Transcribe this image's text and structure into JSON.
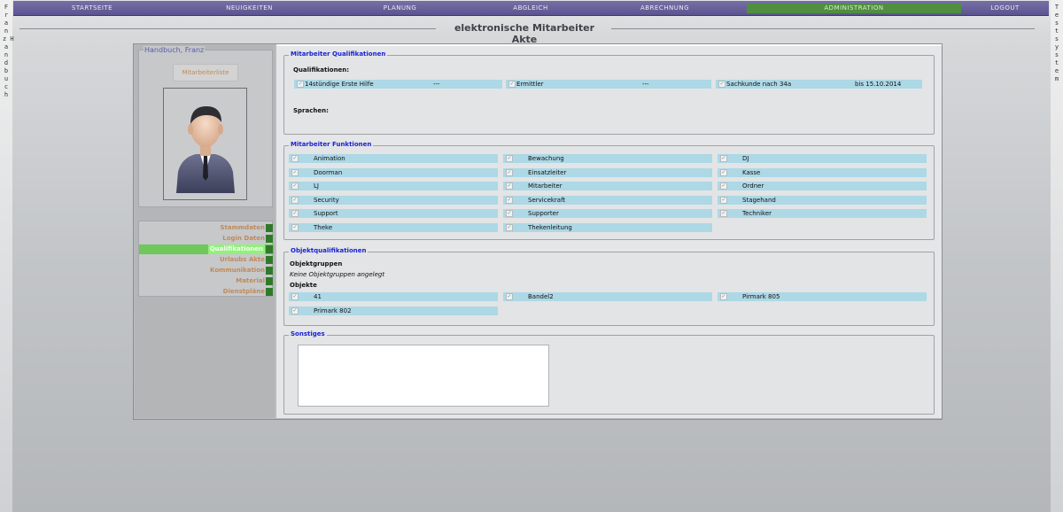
{
  "left_strip": {
    "text": "Franz Handbuch"
  },
  "right_strip": {
    "text": "Testsystem"
  },
  "nav": {
    "items": [
      "STARTSEITE",
      "NEUIGKEITEN",
      "PLANUNG",
      "ABGLEICH",
      "ABRECHNUNG",
      "ADMINISTRATION",
      "LOGOUT"
    ],
    "active": "ADMINISTRATION"
  },
  "page": {
    "title": "elektronische Mitarbeiter Akte"
  },
  "profile": {
    "name": "Handbuch, Franz",
    "list_button": "Mitarbeiterliste"
  },
  "menu": {
    "items": [
      "Stammdaten",
      "Login Daten",
      "Qualifikationen",
      "Urlaubs Akte",
      "Kommunikation",
      "Material",
      "Dienstpläne"
    ],
    "active": "Qualifikationen"
  },
  "qualifications": {
    "legend": "Mitarbeiter Qualifikationen",
    "label": "Qualifikationen:",
    "items": [
      {
        "name": "14stündige Erste Hilfe",
        "value": "---"
      },
      {
        "name": "Ermittler",
        "value": "---"
      },
      {
        "name": "Sachkunde nach 34a",
        "value": "bis 15.10.2014"
      }
    ],
    "languages_label": "Sprachen:"
  },
  "functions": {
    "legend": "Mitarbeiter Funktionen",
    "items": [
      "Animation",
      "Bewachung",
      "DJ",
      "Doorman",
      "Einsatzleiter",
      "Kasse",
      "LJ",
      "Mitarbeiter",
      "Ordner",
      "Security",
      "Servicekraft",
      "Stagehand",
      "Support",
      "Supporter",
      "Techniker",
      "Theke",
      "Thekenleitung"
    ]
  },
  "objects": {
    "legend": "Objektqualifikationen",
    "groups_label": "Objektgruppen",
    "groups_empty": "Keine Objektgruppen angelegt",
    "objects_label": "Objekte",
    "items": [
      "41",
      "Bandel2",
      "Pirmark 805",
      "Primark 802"
    ]
  },
  "misc": {
    "legend": "Sonstiges"
  },
  "colors": {
    "nav_bg": "#5b5490",
    "nav_active": "#4f8f3f",
    "legend_text": "#1a22d6",
    "row_bg": "#add8e6",
    "menu_text": "#c08a5b",
    "menu_active": "#6ec85a"
  }
}
